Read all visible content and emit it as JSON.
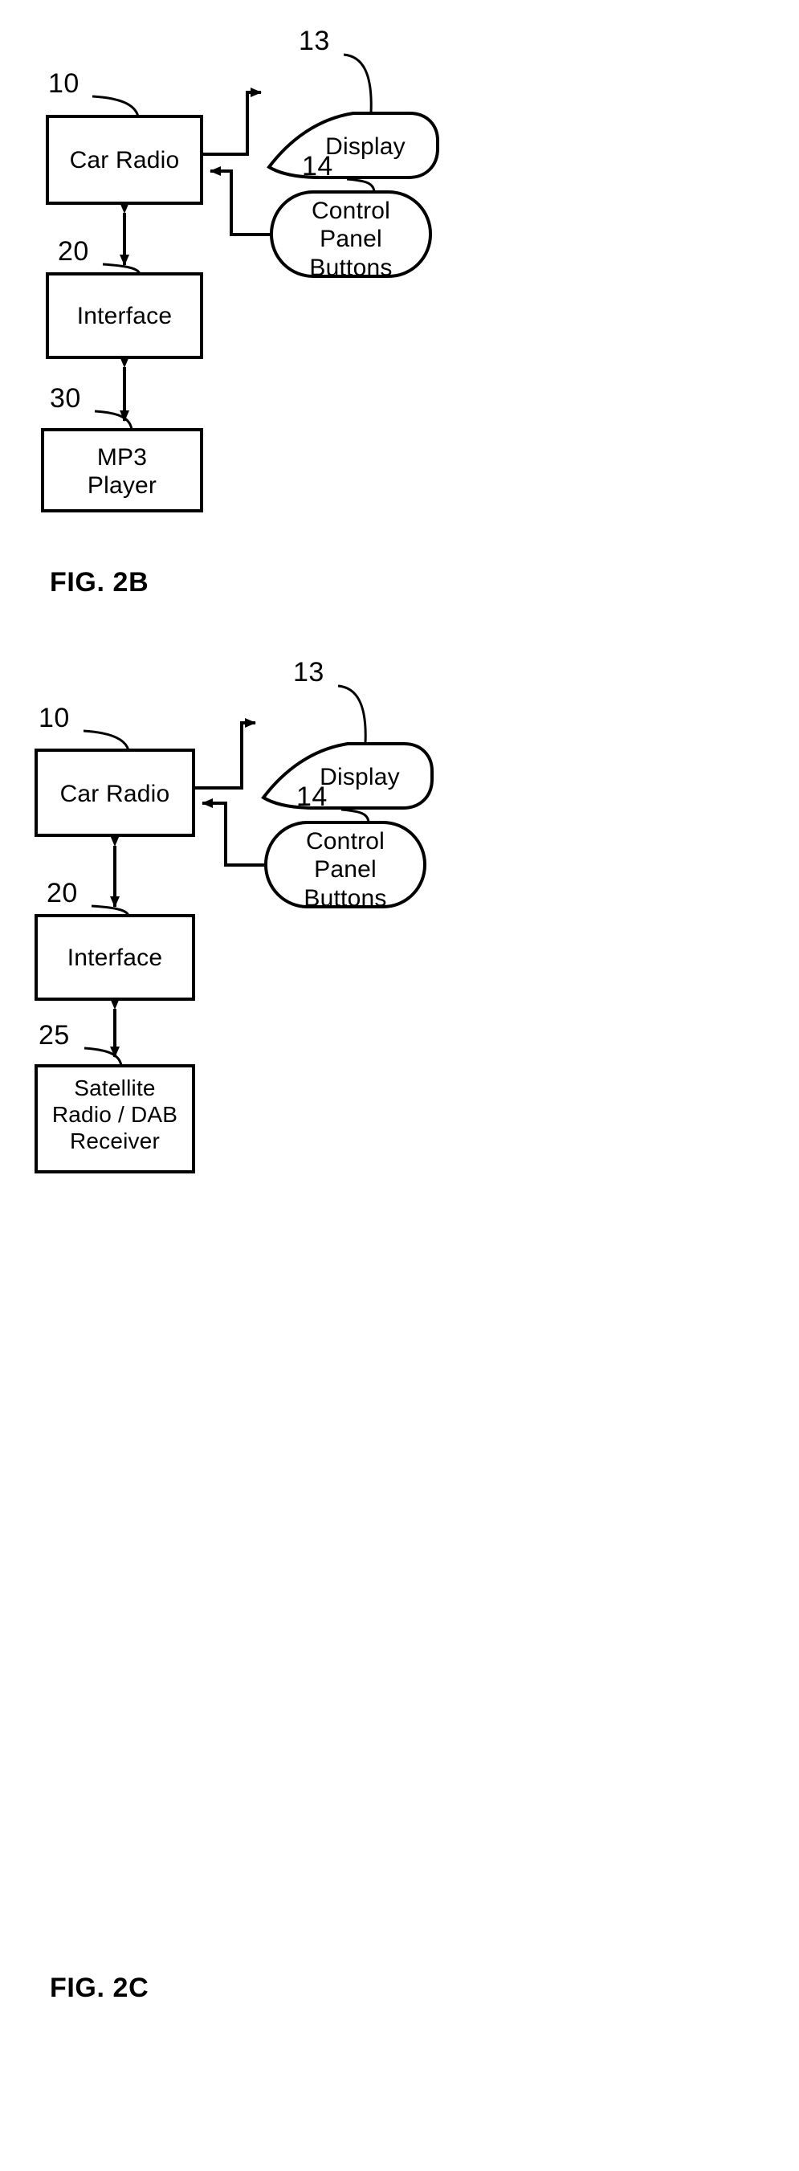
{
  "document": {
    "type": "patent-drawing-sheet",
    "background_color": "#ffffff",
    "line_color": "#000000"
  },
  "figures": [
    {
      "id": "fig-2b",
      "caption": "FIG. 2B",
      "blocks": [
        {
          "id": "car-radio",
          "label": "Car Radio",
          "ref": "10",
          "shape": "rect"
        },
        {
          "id": "display",
          "label": "Display",
          "ref": "13",
          "shape": "leaf"
        },
        {
          "id": "control-panel-buttons",
          "label": "Control\nPanel\nButtons",
          "ref": "14",
          "shape": "pill"
        },
        {
          "id": "interface",
          "label": "Interface",
          "ref": "20",
          "shape": "rect"
        },
        {
          "id": "mp3-player",
          "label": "MP3\nPlayer",
          "ref": "30",
          "shape": "rect"
        }
      ],
      "connections": [
        {
          "from": "car-radio",
          "to": "display",
          "style": "single-arrow"
        },
        {
          "from": "control-panel-buttons",
          "to": "car-radio",
          "style": "single-arrow"
        },
        {
          "from": "car-radio",
          "to": "interface",
          "style": "double-arrow"
        },
        {
          "from": "interface",
          "to": "mp3-player",
          "style": "double-arrow"
        }
      ]
    },
    {
      "id": "fig-2c",
      "caption": "FIG. 2C",
      "blocks": [
        {
          "id": "car-radio",
          "label": "Car Radio",
          "ref": "10",
          "shape": "rect"
        },
        {
          "id": "display",
          "label": "Display",
          "ref": "13",
          "shape": "leaf"
        },
        {
          "id": "control-panel-buttons",
          "label": "Control\nPanel\nButtons",
          "ref": "14",
          "shape": "pill"
        },
        {
          "id": "interface",
          "label": "Interface",
          "ref": "20",
          "shape": "rect"
        },
        {
          "id": "satellite-receiver",
          "label": "Satellite\nRadio / DAB\nReceiver",
          "ref": "25",
          "shape": "rect"
        }
      ],
      "connections": [
        {
          "from": "car-radio",
          "to": "display",
          "style": "single-arrow"
        },
        {
          "from": "control-panel-buttons",
          "to": "car-radio",
          "style": "single-arrow"
        },
        {
          "from": "car-radio",
          "to": "interface",
          "style": "double-arrow"
        },
        {
          "from": "interface",
          "to": "satellite-receiver",
          "style": "double-arrow"
        }
      ]
    }
  ],
  "fig2b": {
    "ref_10": "10",
    "ref_13": "13",
    "ref_14": "14",
    "ref_20": "20",
    "ref_30": "30",
    "car_radio": "Car Radio",
    "display": "Display",
    "control_panel_buttons": "Control\nPanel\nButtons",
    "interface": "Interface",
    "mp3_player": "MP3\nPlayer",
    "caption": "FIG. 2B"
  },
  "fig2c": {
    "ref_10": "10",
    "ref_13": "13",
    "ref_14": "14",
    "ref_20": "20",
    "ref_25": "25",
    "car_radio": "Car Radio",
    "display": "Display",
    "control_panel_buttons": "Control\nPanel\nButtons",
    "interface": "Interface",
    "satellite_receiver": "Satellite\nRadio / DAB\nReceiver",
    "caption": "FIG. 2C"
  }
}
